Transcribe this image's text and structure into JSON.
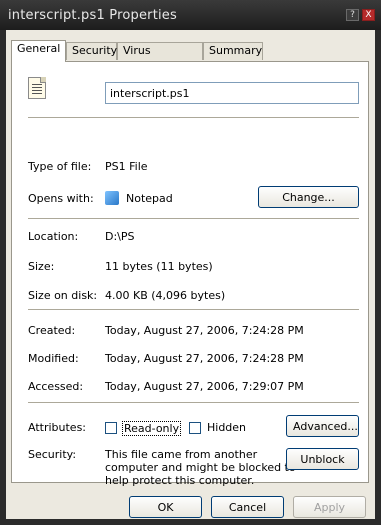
{
  "window": {
    "title": "interscript.ps1 Properties",
    "help_glyph": "?",
    "close_glyph": "X"
  },
  "tabs": [
    "General",
    "Security",
    "Virus Property",
    "Summary"
  ],
  "general": {
    "file_name": "interscript.ps1",
    "type_label": "Type of file:",
    "type_value": "PS1 File",
    "opens_label": "Opens with:",
    "opens_value": "Notepad",
    "change_button": "Change...",
    "location_label": "Location:",
    "location_value": "D:\\PS",
    "size_label": "Size:",
    "size_value": "11 bytes (11 bytes)",
    "size_disk_label": "Size on disk:",
    "size_disk_value": "4.00 KB (4,096 bytes)",
    "created_label": "Created:",
    "created_value": "Today, August 27, 2006, 7:24:28 PM",
    "modified_label": "Modified:",
    "modified_value": "Today, August 27, 2006, 7:24:28 PM",
    "accessed_label": "Accessed:",
    "accessed_value": "Today, August 27, 2006, 7:29:07 PM",
    "attributes_label": "Attributes:",
    "readonly_label": "Read-only",
    "readonly_checked": false,
    "hidden_label": "Hidden",
    "hidden_checked": false,
    "advanced_button": "Advanced...",
    "security_label": "Security:",
    "security_text_1": "This file came from another",
    "security_text_2": "computer and might be blocked to",
    "security_text_3": "help protect this computer.",
    "unblock_button": "Unblock"
  },
  "footer": {
    "ok": "OK",
    "cancel": "Cancel",
    "apply": "Apply"
  },
  "icons": {
    "file": "script-file-icon",
    "notepad": "notepad-icon"
  }
}
